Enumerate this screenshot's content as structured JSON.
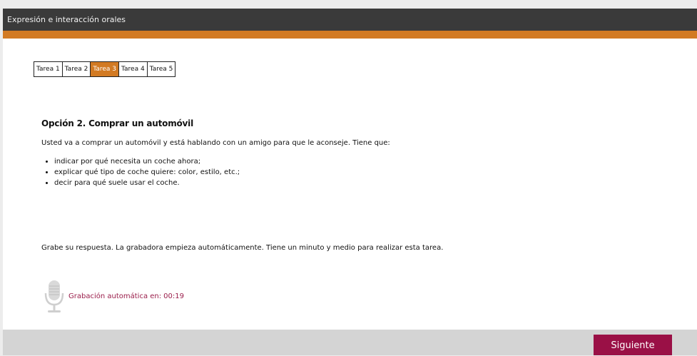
{
  "window": {
    "title": "Expresión e interacción orales"
  },
  "tabs": [
    {
      "label": "Tarea 1",
      "active": false
    },
    {
      "label": "Tarea 2",
      "active": false
    },
    {
      "label": "Tarea 3",
      "active": true
    },
    {
      "label": "Tarea 4",
      "active": false
    },
    {
      "label": "Tarea 5",
      "active": false
    }
  ],
  "task": {
    "heading": "Opción 2. Comprar un automóvil",
    "intro": "Usted va a comprar un automóvil y está hablando con un amigo para que le aconseje. Tiene que:",
    "bullets": [
      "indicar por qué necesita un coche ahora;",
      "explicar qué tipo de coche quiere: color, estilo, etc.;",
      "decir para qué suele usar el coche."
    ],
    "instruction": "Grabe su respuesta. La grabadora empieza automáticamente. Tiene un minuto y medio para realizar esta tarea."
  },
  "recorder": {
    "icon": "microphone-icon",
    "label": "Grabación automática en:",
    "time": "00:19"
  },
  "footer": {
    "next_label": "Siguiente"
  },
  "colors": {
    "titlebar": "#3a3a3a",
    "accent": "#d27a23",
    "button": "#9a1046",
    "countdown": "#9a1d4a"
  }
}
